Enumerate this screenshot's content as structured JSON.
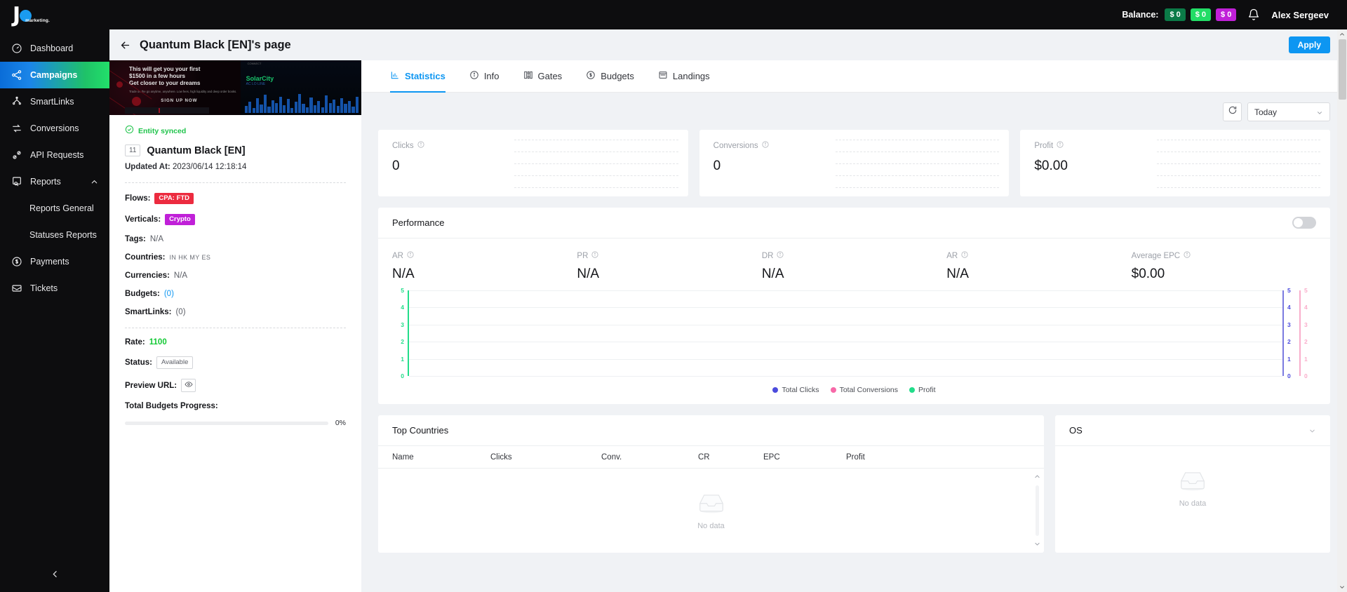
{
  "brand": {
    "logo_text": "J",
    "logo_sub": "marketing."
  },
  "topbar": {
    "balance_label": "Balance:",
    "balances": [
      {
        "text": "$ 0",
        "color": "#0b7a47"
      },
      {
        "text": "$ 0",
        "color": "#22dd66"
      },
      {
        "text": "$ 0",
        "color": "#c020d8"
      }
    ],
    "bell_icon": "bell-icon",
    "username": "Alex Sergeev"
  },
  "sidebar": {
    "items": [
      {
        "label": "Dashboard",
        "icon": "gauge-icon",
        "active": false
      },
      {
        "label": "Campaigns",
        "icon": "share-nodes-icon",
        "active": true
      },
      {
        "label": "SmartLinks",
        "icon": "sitemap-icon",
        "active": false
      },
      {
        "label": "Conversions",
        "icon": "refresh-arrows-icon",
        "active": false
      },
      {
        "label": "API Requests",
        "icon": "plug-icon",
        "active": false
      },
      {
        "label": "Reports",
        "icon": "report-search-icon",
        "active": false,
        "expanded": true
      }
    ],
    "reports_children": [
      "Reports General",
      "Statuses Reports"
    ],
    "items_after": [
      {
        "label": "Payments",
        "icon": "dollar-circle-icon"
      },
      {
        "label": "Tickets",
        "icon": "ticket-icon"
      }
    ],
    "collapse_icon": "chevron-left-icon"
  },
  "page": {
    "back_icon": "arrow-left-icon",
    "title": "Quantum Black [EN]'s page",
    "apply_label": "Apply"
  },
  "banner": {
    "headline_line1": "This will get you your first",
    "headline_line2": "$1500 in a few hours",
    "headline_line3": "Get closer to your dreams",
    "fineprint": "Trade on the go anytime, anywhere. Low fees, high liquidity and deep order books.",
    "cta": "SIGN UP NOW",
    "right_title": "SolarCity",
    "right_sub": "AC LO LINE",
    "right_top": "CONNECT"
  },
  "detail": {
    "synced_label": "Entity synced",
    "synced_icon": "check-circle-icon",
    "entity_id": "11",
    "entity_name": "Quantum Black [EN]",
    "updated_label": "Updated At:",
    "updated_value": "2023/06/14 12:18:14",
    "fields": [
      {
        "label": "Flows:",
        "value": "CPA: FTD",
        "type": "tag",
        "color": "#ec2b3f"
      },
      {
        "label": "Verticals:",
        "value": "Crypto",
        "type": "tag",
        "color": "#c020d8"
      },
      {
        "label": "Tags:",
        "value": "N/A",
        "type": "text"
      },
      {
        "label": "Countries:",
        "value": "IN HK MY ES",
        "type": "countries"
      },
      {
        "label": "Currencies:",
        "value": "N/A",
        "type": "text"
      },
      {
        "label": "Budgets:",
        "value": "(0)",
        "type": "link"
      },
      {
        "label": "SmartLinks:",
        "value": "(0)",
        "type": "muted"
      }
    ],
    "rate_label": "Rate:",
    "rate_value": "1100",
    "status_label": "Status:",
    "status_value": "Available",
    "preview_label": "Preview URL:",
    "preview_icon": "eye-icon",
    "progress_label": "Total Budgets Progress:",
    "progress_pct": "0%",
    "progress_value": 0
  },
  "tabs": [
    {
      "label": "Statistics",
      "icon": "bar-chart-icon",
      "active": true
    },
    {
      "label": "Info",
      "icon": "info-circle-icon",
      "active": false
    },
    {
      "label": "Gates",
      "icon": "gates-icon",
      "active": false
    },
    {
      "label": "Budgets",
      "icon": "dollar-circle-icon",
      "active": false
    },
    {
      "label": "Landings",
      "icon": "window-icon",
      "active": false
    }
  ],
  "filters": {
    "refresh_icon": "refresh-icon",
    "date_range": "Today",
    "caret_icon": "chevron-down-icon"
  },
  "kpis": [
    {
      "label": "Clicks",
      "value": "0",
      "info_icon": "info-icon"
    },
    {
      "label": "Conversions",
      "value": "0",
      "info_icon": "info-icon"
    },
    {
      "label": "Profit",
      "value": "$0.00",
      "info_icon": "info-icon"
    }
  ],
  "performance": {
    "title": "Performance",
    "toggle_on": false,
    "metrics": [
      {
        "label": "AR",
        "value": "N/A",
        "info_icon": "info-icon"
      },
      {
        "label": "PR",
        "value": "N/A",
        "info_icon": "info-icon"
      },
      {
        "label": "DR",
        "value": "N/A",
        "info_icon": "info-icon"
      },
      {
        "label": "AR",
        "value": "N/A",
        "info_icon": "info-icon"
      },
      {
        "label": "Average EPC",
        "value": "$0.00",
        "info_icon": "info-icon"
      }
    ]
  },
  "chart_data": {
    "type": "line",
    "title": "",
    "x": [],
    "series": [
      {
        "name": "Total Clicks",
        "color": "#4b4bdd",
        "values": [],
        "axis": "right-1",
        "ylim": [
          0,
          5
        ]
      },
      {
        "name": "Total Conversions",
        "color": "#f769a8",
        "values": [],
        "axis": "right-2",
        "ylim": [
          0,
          5
        ]
      },
      {
        "name": "Profit",
        "color": "#22dd8a",
        "values": [],
        "axis": "left",
        "ylim": [
          0,
          5
        ]
      }
    ],
    "axes": [
      {
        "id": "left",
        "side": "left",
        "color": "#22dd8a",
        "ticks": [
          5,
          4,
          3,
          2,
          1,
          0
        ]
      },
      {
        "id": "right-1",
        "side": "right",
        "color": "#7b7be0",
        "ticks": [
          5,
          4,
          3,
          2,
          1,
          0
        ]
      },
      {
        "id": "right-2",
        "side": "right",
        "color": "#f9aecb",
        "ticks": [
          5,
          4,
          3,
          2,
          1,
          0
        ]
      }
    ],
    "grid": true,
    "legend_position": "bottom",
    "xlabel": "",
    "ylabel": ""
  },
  "top_countries": {
    "title": "Top Countries",
    "columns": [
      "Name",
      "Clicks",
      "Conv.",
      "CR",
      "EPC",
      "Profit"
    ],
    "rows": [],
    "empty_text": "No data",
    "empty_icon": "empty-inbox-icon",
    "scroll_up_icon": "chevron-up-icon",
    "scroll_down_icon": "chevron-down-icon"
  },
  "os_panel": {
    "title": "OS",
    "caret_icon": "chevron-down-icon",
    "empty_text": "No data",
    "empty_icon": "empty-inbox-icon"
  },
  "page_scrollbar": {
    "up_icon": "chevron-up-icon",
    "down_icon": "chevron-down-icon"
  }
}
